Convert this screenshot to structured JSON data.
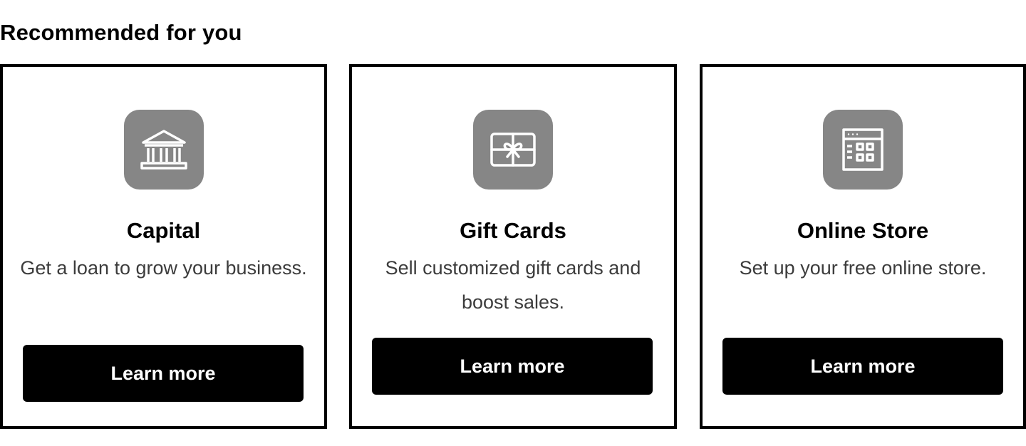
{
  "section": {
    "title": "Recommended for you"
  },
  "cards": [
    {
      "icon": "bank-icon",
      "title": "Capital",
      "description": "Get a loan to grow your business.",
      "button_label": "Learn more"
    },
    {
      "icon": "gift-card-icon",
      "title": "Gift Cards",
      "description": "Sell customized gift cards and boost sales.",
      "button_label": "Learn more"
    },
    {
      "icon": "online-store-icon",
      "title": "Online Store",
      "description": "Set up your free online store.",
      "button_label": "Learn more"
    }
  ],
  "colors": {
    "icon_tile": "#868686",
    "button_background": "#000000",
    "button_text": "#ffffff",
    "card_border": "#000000",
    "description_text": "#3c3c3c"
  }
}
